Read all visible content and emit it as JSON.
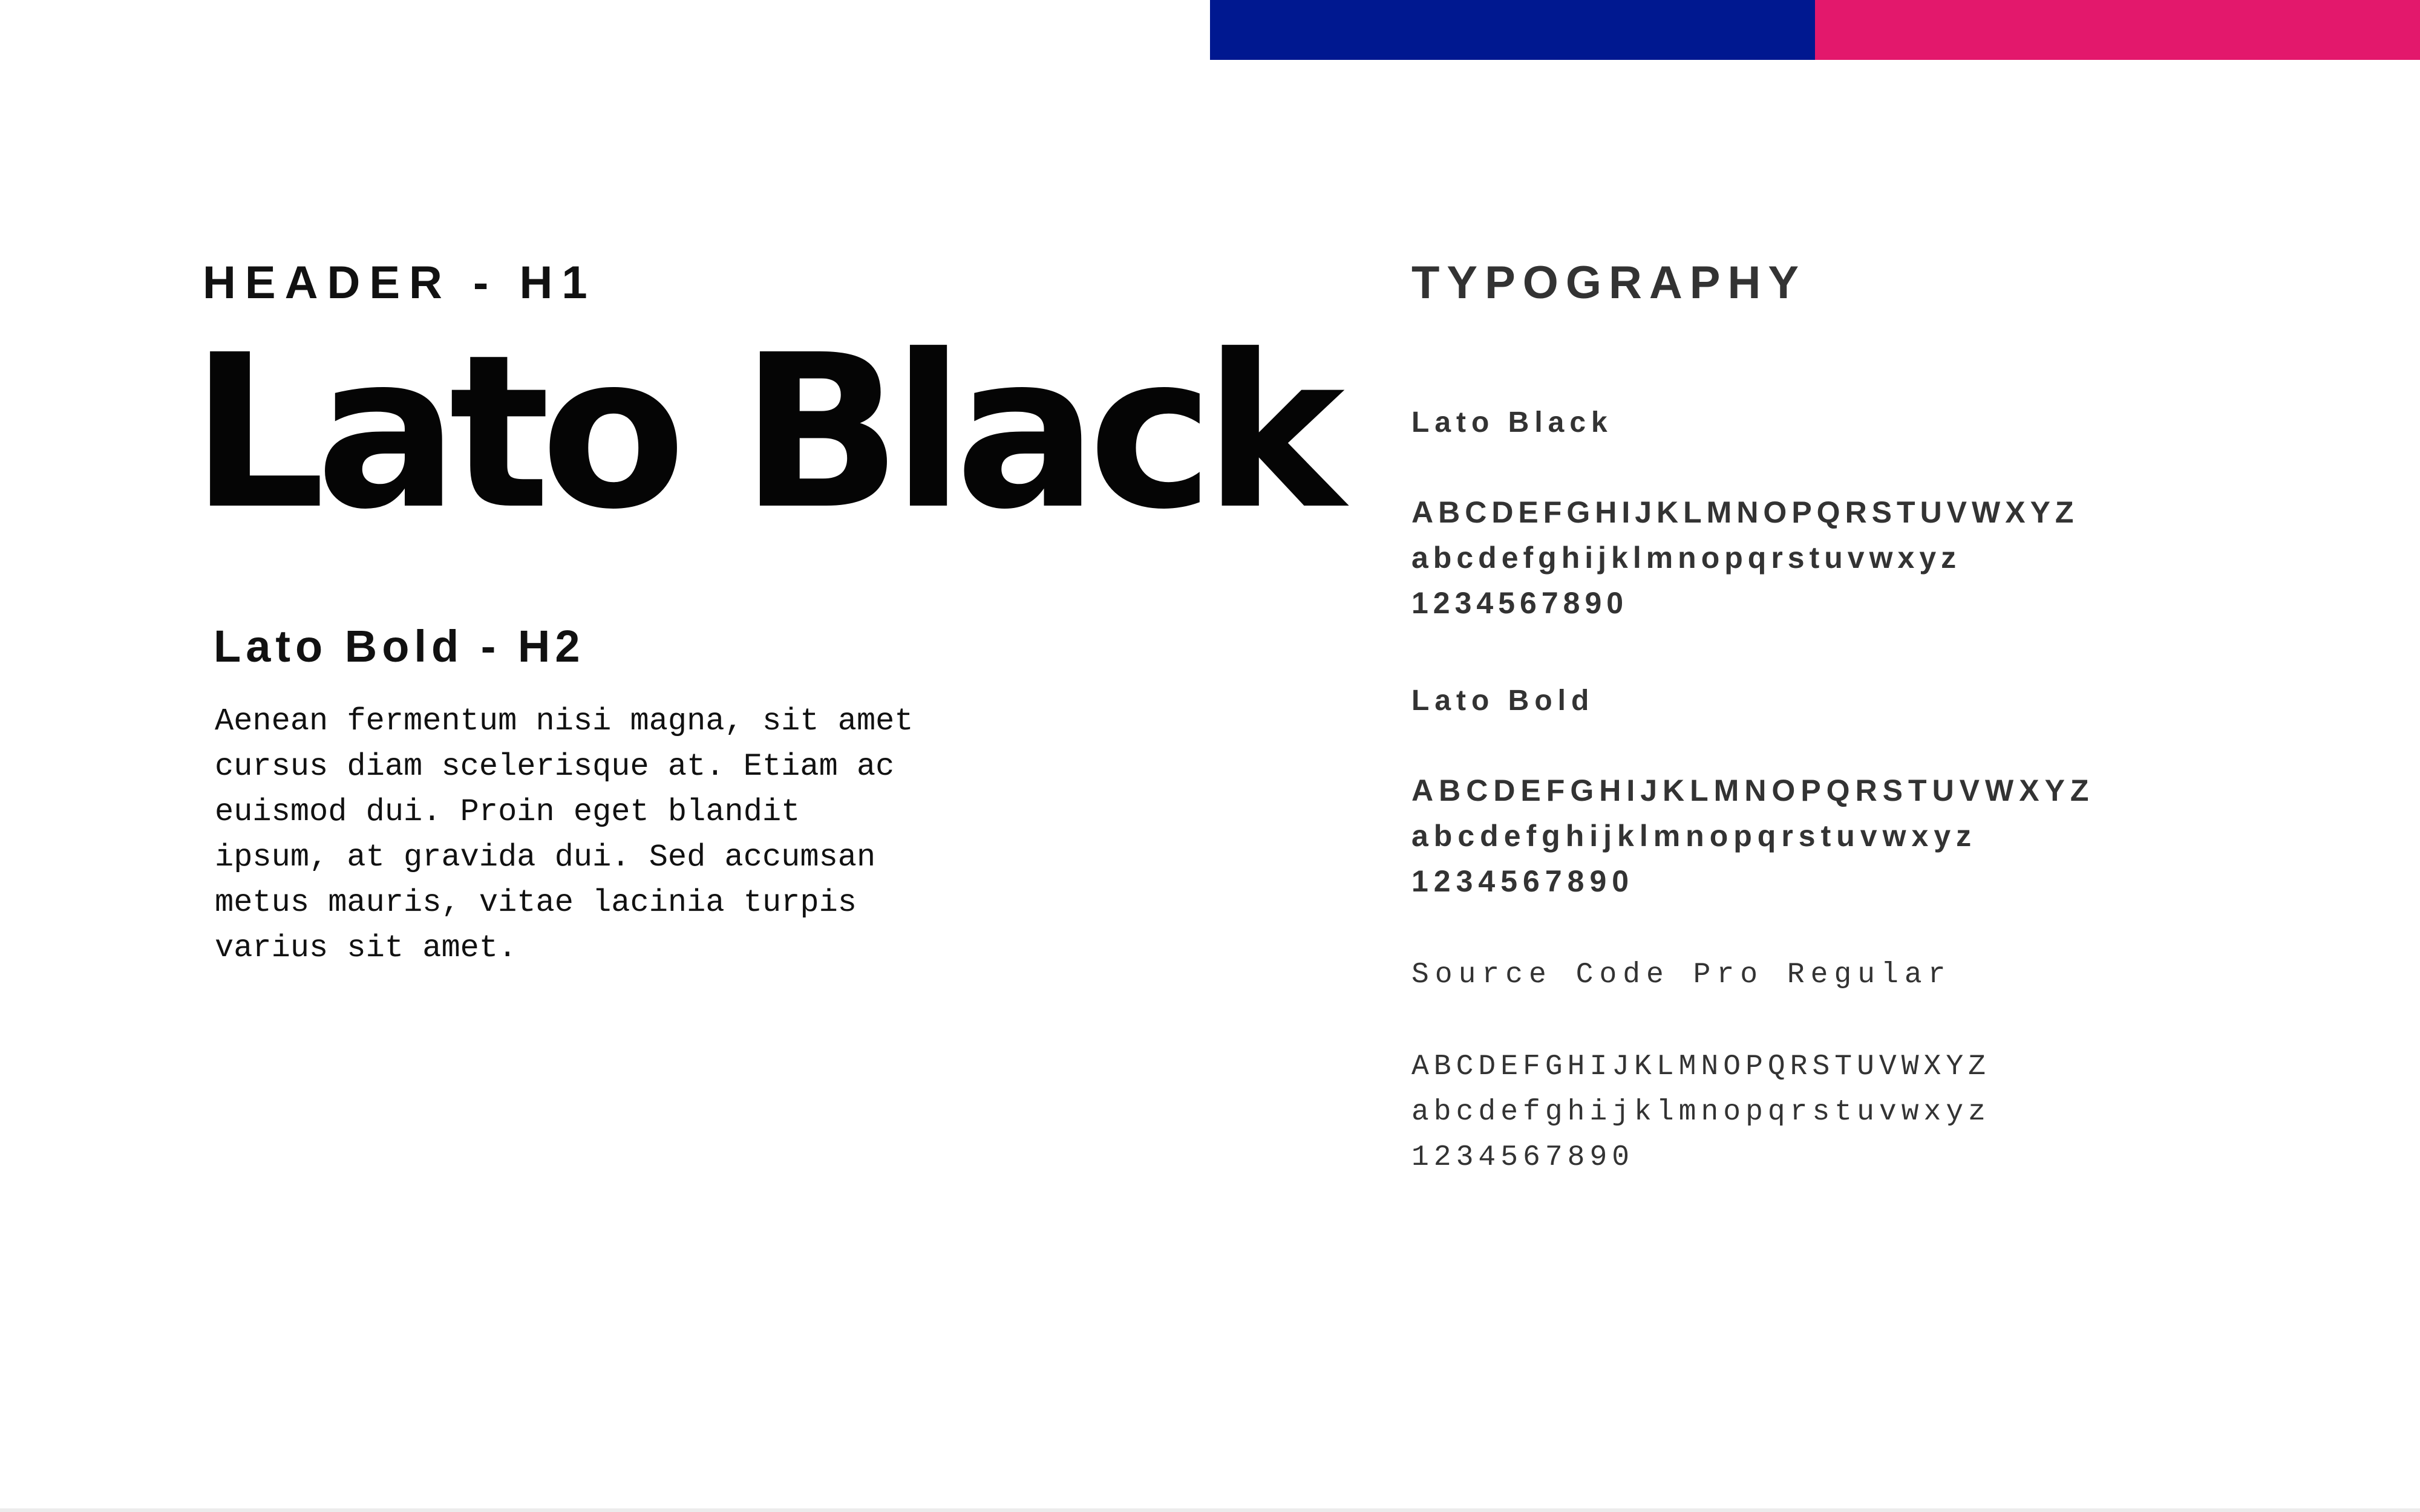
{
  "colors": {
    "bar_blue": "#001890",
    "bar_pink": "#E3186C",
    "text_dark": "#111111",
    "text_gray": "#333333",
    "background": "#FFFFFF"
  },
  "left": {
    "h1_caption": "HEADER - H1",
    "h1_sample": "Lato Black",
    "h2_caption": "Lato Bold - H2",
    "body_text": "Aenean fermentum nisi magna, sit amet\ncursus diam scelerisque at. Etiam ac\neuismod dui. Proin eget blandit\nipsum, at gravida dui. Sed accumsan\nmetus mauris, vitae lacinia turpis\nvarius sit amet."
  },
  "right": {
    "section_title": "TYPOGRAPHY",
    "specimens": [
      {
        "name": "Lato Black",
        "uppercase": "ABCDEFGHIJKLMNOPQRSTUVWXYZ",
        "lowercase": "abcdefghijklmnopqrstuvwxyz",
        "digits": "1234567890"
      },
      {
        "name": "Lato Bold",
        "uppercase": "ABCDEFGHIJKLMNOPQRSTUVWXYZ",
        "lowercase": "abcdefghijklmnopqrstuvwxyz",
        "digits": "1234567890"
      },
      {
        "name": "Source Code Pro Regular",
        "uppercase": "ABCDEFGHIJKLMNOPQRSTUVWXYZ",
        "lowercase": "abcdefghijklmnopqrstuvwxyz",
        "digits": "1234567890"
      }
    ]
  }
}
